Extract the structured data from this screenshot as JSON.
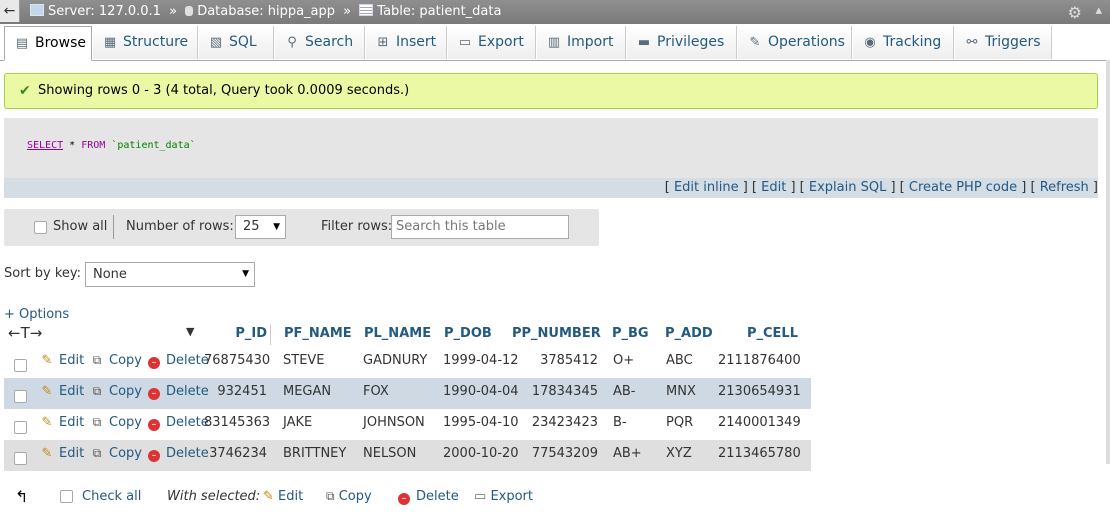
{
  "breadcrumb": {
    "server": "Server: 127.0.0.1",
    "database": "Database: hippa_app",
    "table": "Table: patient_data",
    "separator": "»"
  },
  "tabs": [
    {
      "label": "Browse",
      "icon": "browse-icon",
      "active": true
    },
    {
      "label": "Structure",
      "icon": "structure-icon"
    },
    {
      "label": "SQL",
      "icon": "sql-icon"
    },
    {
      "label": "Search",
      "icon": "search-icon"
    },
    {
      "label": "Insert",
      "icon": "insert-icon"
    },
    {
      "label": "Export",
      "icon": "export-icon"
    },
    {
      "label": "Import",
      "icon": "import-icon"
    },
    {
      "label": "Privileges",
      "icon": "privileges-icon"
    },
    {
      "label": "Operations",
      "icon": "operations-icon"
    },
    {
      "label": "Tracking",
      "icon": "tracking-icon"
    },
    {
      "label": "Triggers",
      "icon": "triggers-icon"
    }
  ],
  "message": "Showing rows 0 - 3 (4 total, Query took 0.0009 seconds.)",
  "query": {
    "select": "SELECT",
    "star": "*",
    "from": "FROM",
    "table": "`patient_data`"
  },
  "query_links": {
    "edit_inline": "Edit inline",
    "edit": "Edit",
    "explain": "Explain SQL",
    "php": "Create PHP code",
    "refresh": "Refresh"
  },
  "nav": {
    "show_all": "Show all",
    "number_of_rows_label": "Number of rows:",
    "number_of_rows": "25",
    "filter_label": "Filter rows:",
    "filter_placeholder": "Search this table"
  },
  "sort": {
    "label": "Sort by key:",
    "value": "None"
  },
  "options_link": "+ Options",
  "table": {
    "columns": [
      "P_ID",
      "PF_NAME",
      "PL_NAME",
      "P_DOB",
      "PP_NUMBER",
      "P_BG",
      "P_ADD",
      "P_CELL"
    ],
    "row_actions": {
      "edit": "Edit",
      "copy": "Copy",
      "delete": "Delete"
    },
    "rows": [
      [
        "76875430",
        "STEVE",
        "GADNURY",
        "1999-04-12",
        "3785412",
        "O+",
        "ABC",
        "2111876400"
      ],
      [
        "932451",
        "MEGAN",
        "FOX",
        "1990-04-04",
        "17834345",
        "AB-",
        "MNX",
        "2130654931"
      ],
      [
        "83145363",
        "JAKE",
        "JOHNSON",
        "1995-04-10",
        "23423423",
        "B-",
        "PQR",
        "2140001349"
      ],
      [
        "3746234",
        "BRITTNEY",
        "NELSON",
        "2000-10-20",
        "77543209",
        "AB+",
        "XYZ",
        "2113465780"
      ]
    ]
  },
  "bottom": {
    "check_all": "Check all",
    "with_selected": "With selected:",
    "edit": "Edit",
    "copy": "Copy",
    "delete": "Delete",
    "export": "Export"
  },
  "colors": {
    "link": "#235a81",
    "success_bg": "#ebf8a4",
    "success_border": "#a2d246",
    "row_highlight": "#ced9e4"
  }
}
